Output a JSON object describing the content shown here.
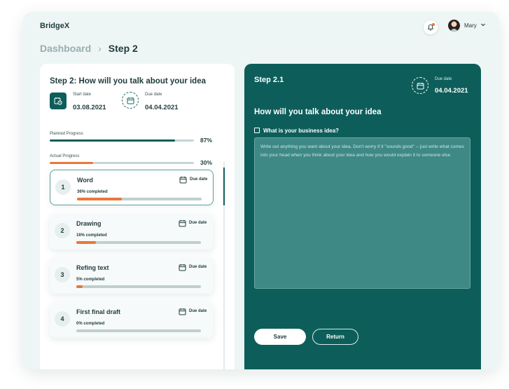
{
  "app": {
    "brand": "BridgeX"
  },
  "header": {
    "user_name": "Mary"
  },
  "breadcrumb": {
    "parent": "Dashboard",
    "separator": "›",
    "current": "Step 2"
  },
  "left": {
    "title": "Step 2: How will you talk about your idea",
    "start_label": "Start date",
    "start_date": "03.08.2021",
    "due_label": "Due date",
    "due_date": "04.04.2021",
    "planned_label": "Planned Progress",
    "planned_pct": "87%",
    "planned_value": 87,
    "actual_label": "Actual Progress",
    "actual_pct": "30%",
    "actual_value": 30,
    "steps": [
      {
        "num": "1",
        "title": "Word",
        "due": "Due date",
        "completed": "36% completed",
        "value": 36
      },
      {
        "num": "2",
        "title": "Drawing",
        "due": "Due date",
        "completed": "16% completed",
        "value": 16
      },
      {
        "num": "3",
        "title": "Refing text",
        "due": "Due date",
        "completed": "5% completed",
        "value": 5
      },
      {
        "num": "4",
        "title": "First final draft",
        "due": "Due date",
        "completed": "0% completed",
        "value": 0
      }
    ]
  },
  "right": {
    "step": "Step 2.1",
    "due_label": "Due date",
    "due_date": "04.04.2021",
    "heading": "How will you talk about your idea",
    "question": "What is your business idea?",
    "placeholder": "Write out anything you want about your idea. Don't worry if it \"sounds good\" -- just write what comes into your head when you think about your idea and how you would explain it to someone else",
    "save_label": "Save",
    "return_label": "Return"
  },
  "colors": {
    "accent": "#0d5e5a",
    "progress": "#e8783a",
    "track": "#c5d6d6",
    "background": "#eef5f5"
  },
  "icons": {
    "bell": "bell-icon",
    "calendar": "calendar-icon",
    "chevron": "chevron-down-icon"
  }
}
